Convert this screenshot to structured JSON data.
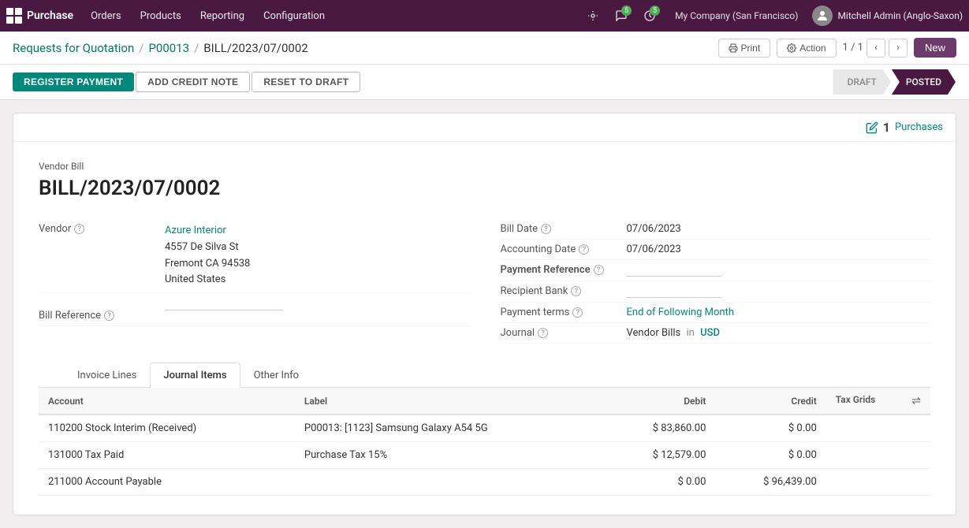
{
  "app": {
    "name": "Purchase",
    "nav_items": [
      "Orders",
      "Products",
      "Reporting",
      "Configuration"
    ]
  },
  "nav_right": {
    "bug_icon": "🐛",
    "chat_icon": "💬",
    "chat_badge": "5",
    "clock_icon": "🕐",
    "clock_badge": "5",
    "company": "My Company (San Francisco)",
    "user": "Mitchell Admin (Anglo-Saxon)"
  },
  "breadcrumb": {
    "part1": "Requests for Quotation",
    "sep1": "/",
    "part2": "P00013",
    "sep2": "/",
    "part3": "BILL/2023/07/0002"
  },
  "header_actions": {
    "print": "Print",
    "action": "Action",
    "page": "1 / 1",
    "new": "New"
  },
  "action_buttons": {
    "register": "REGISTER PAYMENT",
    "credit": "ADD CREDIT NOTE",
    "draft": "RESET TO DRAFT"
  },
  "status_steps": [
    {
      "label": "DRAFT",
      "active": false
    },
    {
      "label": "POSTED",
      "active": true
    }
  ],
  "purchases_link": {
    "count": "1",
    "label": "Purchases",
    "icon": "✏"
  },
  "document": {
    "doc_label": "Vendor Bill",
    "doc_title": "BILL/2023/07/0002",
    "vendor_label": "Vendor",
    "vendor_name": "Azure Interior",
    "vendor_address1": "4557 De Silva St",
    "vendor_address2": "Fremont CA 94538",
    "vendor_address3": "United States",
    "bill_ref_label": "Bill Reference",
    "bill_date_label": "Bill Date",
    "bill_date_value": "07/06/2023",
    "accounting_date_label": "Accounting Date",
    "accounting_date_value": "07/06/2023",
    "payment_ref_label": "Payment Reference",
    "payment_ref_value": "",
    "recipient_bank_label": "Recipient Bank",
    "recipient_bank_value": "",
    "payment_terms_label": "Payment terms",
    "payment_terms_value": "End of Following Month",
    "journal_label": "Journal",
    "journal_value": "Vendor Bills",
    "journal_in": "in",
    "journal_currency": "USD"
  },
  "tabs": [
    {
      "id": "invoice-lines",
      "label": "Invoice Lines",
      "active": false
    },
    {
      "id": "journal-items",
      "label": "Journal Items",
      "active": true
    },
    {
      "id": "other-info",
      "label": "Other Info",
      "active": false
    }
  ],
  "journal_table": {
    "columns": [
      {
        "key": "account",
        "label": "Account",
        "align": "left"
      },
      {
        "key": "label",
        "label": "Label",
        "align": "left"
      },
      {
        "key": "debit",
        "label": "Debit",
        "align": "right"
      },
      {
        "key": "credit",
        "label": "Credit",
        "align": "right"
      },
      {
        "key": "tax_grids",
        "label": "Tax Grids",
        "align": "left"
      }
    ],
    "rows": [
      {
        "account": "110200 Stock Interim (Received)",
        "label": "P00013: [1123] Samsung Galaxy A54 5G",
        "debit": "$ 83,860.00",
        "credit": "$ 0.00",
        "tax_grids": ""
      },
      {
        "account": "131000 Tax Paid",
        "label": "Purchase Tax 15%",
        "debit": "$ 12,579.00",
        "credit": "$ 0.00",
        "tax_grids": ""
      },
      {
        "account": "211000 Account Payable",
        "label": "",
        "debit": "$ 0.00",
        "credit": "$ 96,439.00",
        "tax_grids": ""
      }
    ]
  }
}
